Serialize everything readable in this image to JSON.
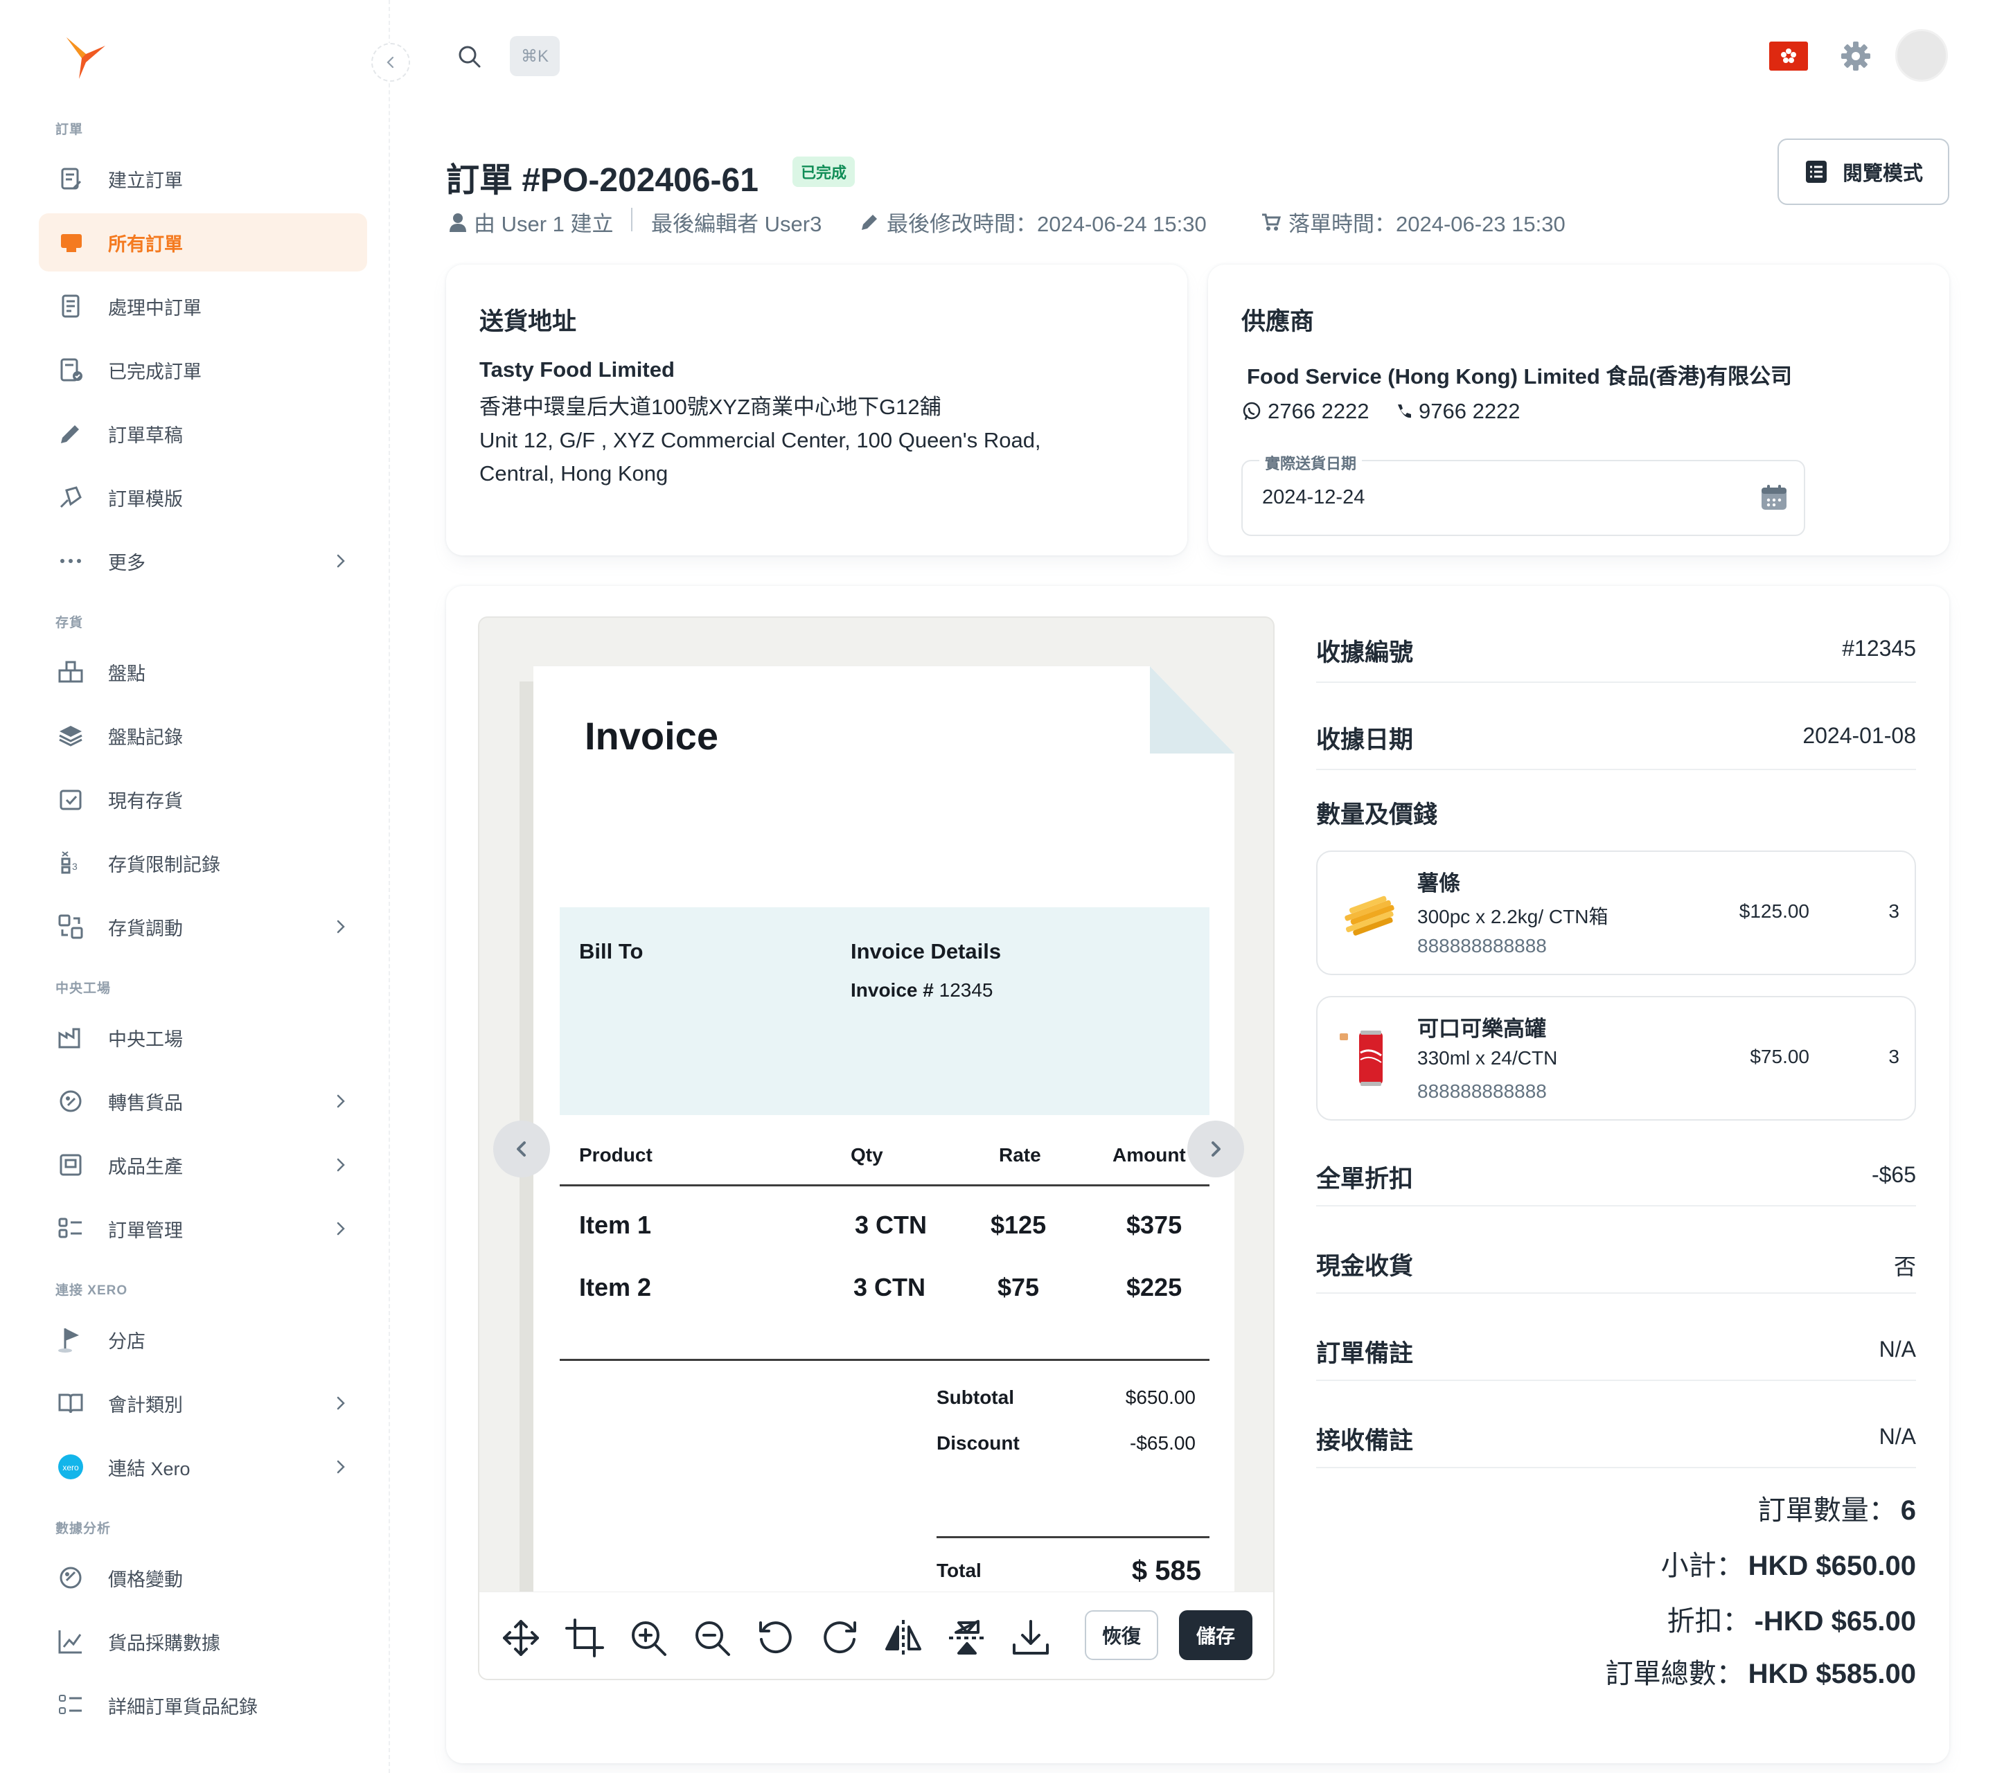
{
  "sidebar": {
    "sections": [
      {
        "title": "訂單",
        "items": [
          {
            "label": "建立訂單",
            "icon": "create-order-icon",
            "chevron": false
          },
          {
            "label": "所有訂單",
            "icon": "all-orders-icon",
            "chevron": false,
            "active": true
          },
          {
            "label": "處理中訂單",
            "icon": "processing-orders-icon",
            "chevron": false
          },
          {
            "label": "已完成訂單",
            "icon": "completed-orders-icon",
            "chevron": false
          },
          {
            "label": "訂單草稿",
            "icon": "pencil-icon",
            "chevron": false
          },
          {
            "label": "訂單模版",
            "icon": "template-icon",
            "chevron": false
          },
          {
            "label": "更多",
            "icon": "more-dots-icon",
            "chevron": true
          }
        ]
      },
      {
        "title": "存貨",
        "items": [
          {
            "label": "盤點",
            "icon": "stocktake-icon",
            "chevron": false
          },
          {
            "label": "盤點記錄",
            "icon": "stocktake-record-icon",
            "chevron": false
          },
          {
            "label": "現有存貨",
            "icon": "inventory-icon",
            "chevron": false
          },
          {
            "label": "存貨限制記錄",
            "icon": "inventory-limit-icon",
            "chevron": false
          },
          {
            "label": "存貨調動",
            "icon": "transfer-icon",
            "chevron": true
          }
        ]
      },
      {
        "title": "中央工場",
        "items": [
          {
            "label": "中央工場",
            "icon": "factory-icon",
            "chevron": false
          },
          {
            "label": "轉售貨品",
            "icon": "resale-icon",
            "chevron": true
          },
          {
            "label": "成品生產",
            "icon": "production-icon",
            "chevron": true
          },
          {
            "label": "訂單管理",
            "icon": "order-management-icon",
            "chevron": true
          }
        ]
      },
      {
        "title": "連接 XERO",
        "items": [
          {
            "label": "分店",
            "icon": "branch-flag-icon",
            "chevron": false
          },
          {
            "label": "會計類別",
            "icon": "book-icon",
            "chevron": true
          },
          {
            "label": "連結 Xero",
            "icon": "xero-logo-icon",
            "chevron": true
          }
        ]
      },
      {
        "title": "數據分析",
        "items": [
          {
            "label": "價格變動",
            "icon": "price-change-icon",
            "chevron": false
          },
          {
            "label": "貨品採購數據",
            "icon": "purchase-chart-icon",
            "chevron": false
          },
          {
            "label": "詳細訂單貨品紀錄",
            "icon": "detail-list-icon",
            "chevron": false
          }
        ]
      }
    ]
  },
  "topbar": {
    "shortcut": "⌘K"
  },
  "header": {
    "title": "訂單 #PO-202406-61",
    "status": "已完成",
    "created_by": "由 User 1 建立",
    "last_editor": "最後編輯者 User3",
    "modified": "最後修改時間：2024-06-24 15:30",
    "ordered": "落單時間：2024-06-23 15:30",
    "view_mode_label": "閱覽模式"
  },
  "delivery": {
    "title": "送貨地址",
    "name": "Tasty Food Limited",
    "address_zh": "香港中環皇后大道100號XYZ商業中心地下G12舖",
    "address_en_1": "Unit 12, G/F , XYZ Commercial Center, 100 Queen's Road,",
    "address_en_2": "Central, Hong Kong"
  },
  "supplier": {
    "title": "供應商",
    "name": "Food Service (Hong Kong) Limited 食品(香港)有限公司",
    "whatsapp": "2766 2222",
    "phone": "9766 2222",
    "date_label": "實際送貨日期",
    "date_value": "2024-12-24"
  },
  "invoice": {
    "title": "Invoice",
    "bill_to": "Bill To",
    "details_title": "Invoice Details",
    "number_label": "Invoice #",
    "number": "12345",
    "columns": [
      "Product",
      "Qty",
      "Rate",
      "Amount"
    ],
    "rows": [
      {
        "product": "Item 1",
        "qty": "3 CTN",
        "rate": "$125",
        "amount": "$375"
      },
      {
        "product": "Item 2",
        "qty": "3 CTN",
        "rate": "$75",
        "amount": "$225"
      }
    ],
    "subtotal_label": "Subtotal",
    "subtotal": "$650.00",
    "discount_label": "Discount",
    "discount": "-$65.00",
    "total_label": "Total",
    "total": "$ 585"
  },
  "viewer_toolbar": {
    "restore_label": "恢復",
    "save_label": "儲存"
  },
  "details": {
    "receipt_no_label": "收據編號",
    "receipt_no": "#12345",
    "receipt_date_label": "收據日期",
    "receipt_date": "2024-01-08",
    "qty_price_label": "數量及價錢",
    "items": [
      {
        "name": "薯條",
        "spec": "300pc x 2.2kg/ CTN箱",
        "code": "888888888888",
        "price": "$125.00",
        "qty": "3",
        "thumb": "fries-icon"
      },
      {
        "name": "可口可樂高罐",
        "spec": "330ml x 24/CTN",
        "code": "888888888888",
        "price": "$75.00",
        "qty": "3",
        "thumb": "coke-can-icon"
      }
    ],
    "discount_label": "全單折扣",
    "discount": "-$65",
    "cash_label": "現金收貨",
    "cash": "否",
    "order_note_label": "訂單備註",
    "order_note": "N/A",
    "receive_note_label": "接收備註",
    "receive_note": "N/A"
  },
  "summary": {
    "qty_label": "訂單數量：",
    "qty": "6",
    "subtotal_label": "小計：",
    "subtotal": "HKD $650.00",
    "discount_label": "折扣：",
    "discount": "-HKD $65.00",
    "total_label": "訂單總數：",
    "total": "HKD $585.00"
  },
  "colors": {
    "accent": "#f47a20",
    "active_bg": "#fdf1e7",
    "success_bg": "#dbf6e5",
    "success_text": "#118d57",
    "invoice_band": "#e9f4f6",
    "dark_button": "#212b36"
  }
}
